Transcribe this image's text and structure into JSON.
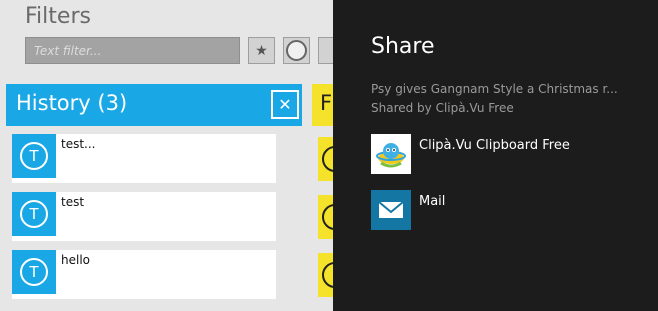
{
  "filters": {
    "title": "Filters",
    "text_filter_placeholder": "Text filter...",
    "star_icon": "star-icon",
    "circle_icon": "circle-icon"
  },
  "history": {
    "title": "History (3)",
    "close_icon": "close-icon",
    "items": [
      {
        "icon_letter": "T",
        "text": "test..."
      },
      {
        "icon_letter": "T",
        "text": "test"
      },
      {
        "icon_letter": "T",
        "text": "hello"
      }
    ]
  },
  "favorites": {
    "title_partial": "F"
  },
  "share": {
    "title": "Share",
    "description_line1": "Psy gives Gangnam Style a Christmas r...",
    "description_line2": "Shared by Clipà.Vu Free",
    "targets": [
      {
        "label": "Clipà.Vu Clipboard Free",
        "icon": "clipavu-app-icon"
      },
      {
        "label": "Mail",
        "icon": "mail-icon"
      }
    ]
  },
  "colors": {
    "accent_blue": "#1aa7e5",
    "accent_yellow": "#f4e32a",
    "share_panel_bg": "#1c1c1c",
    "mail_tile": "#1476a3"
  }
}
